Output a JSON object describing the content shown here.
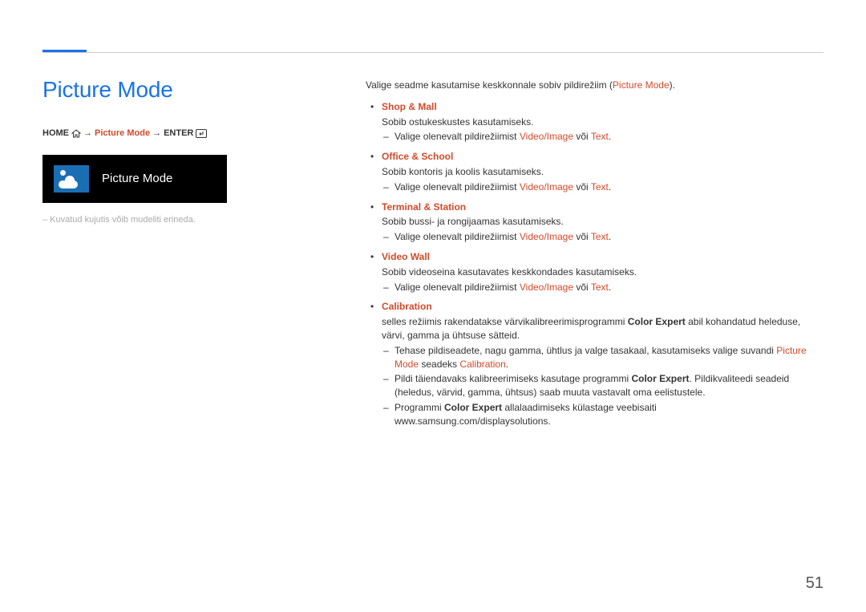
{
  "page_number": "51",
  "title": "Picture Mode",
  "breadcrumb": {
    "home": "HOME",
    "arrow": "→",
    "mid": "Picture Mode",
    "enter": "ENTER"
  },
  "tv": {
    "label": "Picture Mode"
  },
  "caption": "– Kuvatud kujutis võib mudeliti erineda.",
  "intro": {
    "pre": "Valige seadme kasutamise keskkonnale sobiv pildirežiim (",
    "em": "Picture Mode",
    "post": ")."
  },
  "sub_line": {
    "pre": "Valige olenevalt pildirežiimist ",
    "em1": "Video/Image",
    "mid": " või ",
    "em2": "Text",
    "post": "."
  },
  "modes": [
    {
      "name": "Shop & Mall",
      "desc": "Sobib ostukeskustes kasutamiseks.",
      "has_sub": true
    },
    {
      "name": "Office & School",
      "desc": "Sobib kontoris ja koolis kasutamiseks.",
      "has_sub": true
    },
    {
      "name": "Terminal & Station",
      "desc": "Sobib bussi- ja rongijaamas kasutamiseks.",
      "has_sub": true
    },
    {
      "name": "Video Wall",
      "desc": "Sobib videoseina kasutavates keskkondades kasutamiseks.",
      "has_sub": true
    }
  ],
  "calibration": {
    "name": "Calibration",
    "desc_pre": "selles režiimis rakendatakse värvikalibreerimisprogrammi ",
    "desc_bold": "Color Expert",
    "desc_post": " abil kohandatud heleduse, värvi, gamma ja ühtsuse sätteid.",
    "n1_pre": "Tehase pildiseadete, nagu gamma, ühtlus ja valge tasakaal, kasutamiseks valige suvandi ",
    "n1_em1": "Picture Mode",
    "n1_mid": " seadeks ",
    "n1_em2": "Calibration",
    "n1_post": ".",
    "n2_pre": "Pildi täiendavaks kalibreerimiseks kasutage programmi ",
    "n2_bold": "Color Expert",
    "n2_post": ". Pildikvaliteedi seadeid (heledus, värvid, gamma, ühtsus) saab muuta vastavalt oma eelistustele.",
    "n3_pre": "Programmi ",
    "n3_bold": "Color Expert",
    "n3_post": " allalaadimiseks külastage veebisaiti www.samsung.com/displaysolutions."
  }
}
